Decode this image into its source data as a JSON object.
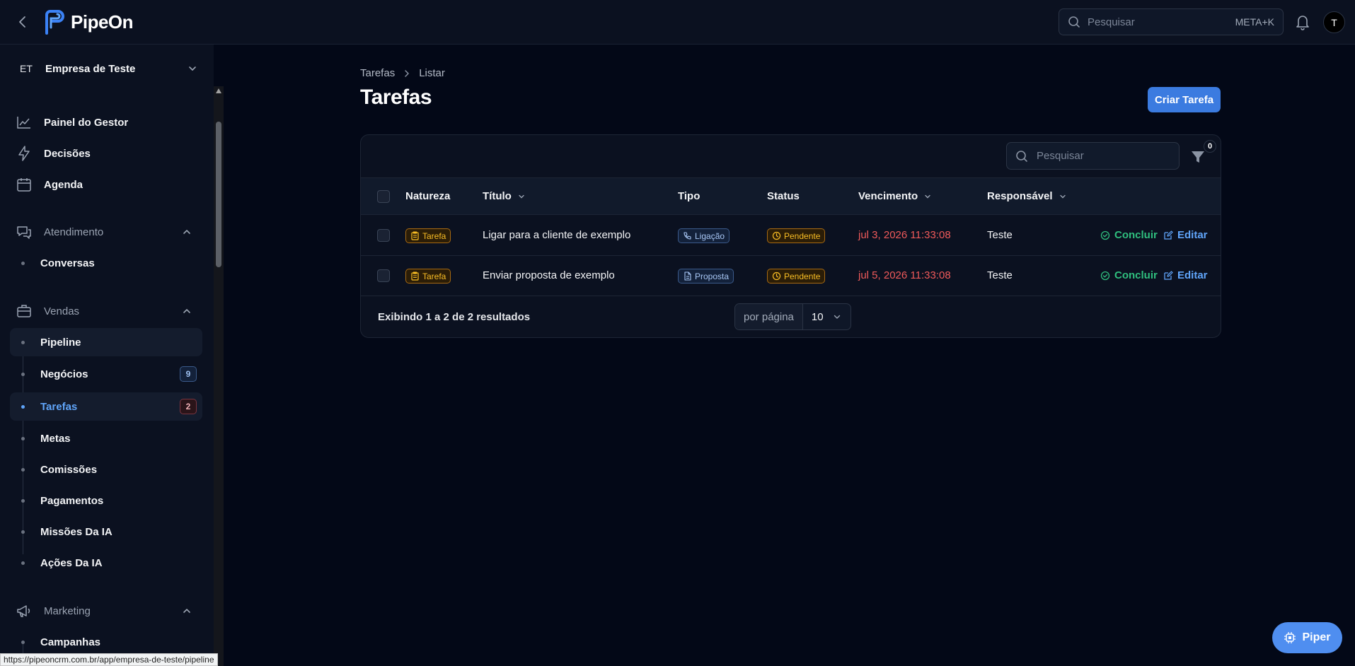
{
  "app": {
    "name": "PipeOn"
  },
  "header": {
    "search_placeholder": "Pesquisar",
    "search_shortcut": "META+K",
    "avatar_initial": "T"
  },
  "sidebar": {
    "company_initials": "ET",
    "company_name": "Empresa de Teste",
    "items": [
      {
        "label": "Painel do Gestor",
        "icon": "chart-line-icon"
      },
      {
        "label": "Decisões",
        "icon": "lightning-icon"
      },
      {
        "label": "Agenda",
        "icon": "calendar-icon"
      }
    ],
    "groups": {
      "atendimento": {
        "label": "Atendimento",
        "icon": "chat-bubbles-icon",
        "items": [
          "Conversas"
        ]
      },
      "vendas": {
        "label": "Vendas",
        "icon": "briefcase-icon",
        "items": [
          {
            "label": "Pipeline"
          },
          {
            "label": "Negócios",
            "badge": "9"
          },
          {
            "label": "Tarefas",
            "badge": "2"
          },
          {
            "label": "Metas"
          },
          {
            "label": "Comissões"
          },
          {
            "label": "Pagamentos"
          },
          {
            "label": "Missões Da IA"
          },
          {
            "label": "Ações Da IA"
          }
        ]
      },
      "marketing": {
        "label": "Marketing",
        "icon": "megaphone-icon",
        "items": [
          "Campanhas"
        ]
      }
    }
  },
  "status_url": "https://pipeoncrm.com.br/app/empresa-de-teste/pipeline",
  "main": {
    "breadcrumb": [
      "Tarefas",
      "Listar"
    ],
    "title": "Tarefas",
    "create_button": "Criar Tarefa",
    "table": {
      "search_placeholder": "Pesquisar",
      "filter_count": "0",
      "columns": [
        "Natureza",
        "Título",
        "Tipo",
        "Status",
        "Vencimento",
        "Responsável"
      ],
      "rows": [
        {
          "natureza": "Tarefa",
          "titulo": "Ligar para a cliente de exemplo",
          "tipo": "Ligação",
          "status": "Pendente",
          "vencimento": "jul 3, 2026 11:33:08",
          "responsavel": "Teste"
        },
        {
          "natureza": "Tarefa",
          "titulo": "Enviar proposta de exemplo",
          "tipo": "Proposta",
          "status": "Pendente",
          "vencimento": "jul 5, 2026 11:33:08",
          "responsavel": "Teste"
        }
      ],
      "actions": {
        "complete": "Concluir",
        "edit": "Editar"
      },
      "footer_info": "Exibindo 1 a 2 de 2 resultados",
      "per_page_label": "por página",
      "per_page_value": "10"
    }
  },
  "piper_button": "Piper",
  "colors": {
    "accent": "#3b7be0",
    "due_date": "#f05a5a",
    "pending": "#fbbf24",
    "success": "#2fbf7e"
  }
}
